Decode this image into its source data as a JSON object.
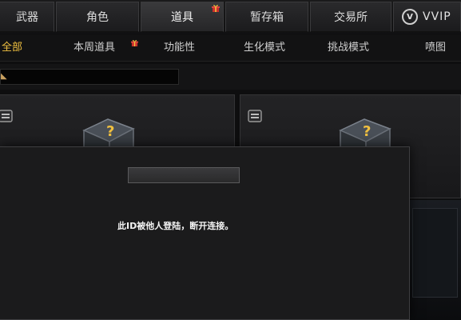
{
  "top_tabs": [
    {
      "label": "武器"
    },
    {
      "label": "角色"
    },
    {
      "label": "道具"
    },
    {
      "label": "暂存箱"
    },
    {
      "label": "交易所"
    }
  ],
  "vvip": {
    "label": "VVIP",
    "emblem": "V"
  },
  "sub_tabs": [
    {
      "label": "全部"
    },
    {
      "label": "本周道具"
    },
    {
      "label": "功能性"
    },
    {
      "label": "生化模式"
    },
    {
      "label": "挑战模式"
    },
    {
      "label": "喷图"
    }
  ],
  "dialog": {
    "message": "此ID被他人登陆，断开连接。"
  },
  "icons": {
    "gift_badge": "gift-icon",
    "shop": "shop-icon",
    "mystery_box": "mystery-box-icon"
  },
  "colors": {
    "active_subtab": "#f0c040",
    "dialog_bg": "#1b1b1c"
  }
}
